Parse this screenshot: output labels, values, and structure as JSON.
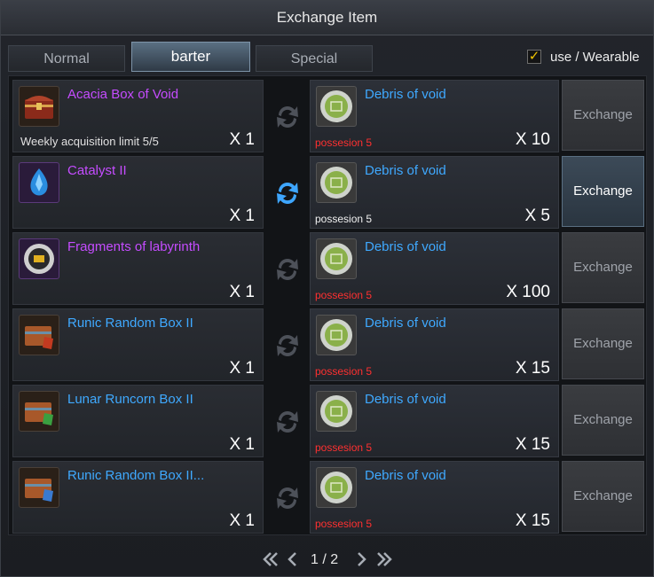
{
  "window": {
    "title": "Exchange Item"
  },
  "tabs": [
    {
      "label": "Normal"
    },
    {
      "label": "barter"
    },
    {
      "label": "Special"
    }
  ],
  "filter": {
    "label": "use / Wearable",
    "checked": true
  },
  "rows": [
    {
      "give_name": "Acacia Box of Void",
      "give_weekly": "Weekly acquisition limit 5/5",
      "give_qty": "X 1",
      "get_name": "Debris of void",
      "get_possession": "possesion 5",
      "get_qty": "X 10",
      "button": "Exchange"
    },
    {
      "give_name": "Catalyst II",
      "give_qty": "X 1",
      "get_name": "Debris of void",
      "get_possession": "possesion 5",
      "get_qty": "X 5",
      "button": "Exchange"
    },
    {
      "give_name": "Fragments of labyrinth",
      "give_qty": "X 1",
      "get_name": "Debris of void",
      "get_possession": "possesion 5",
      "get_qty": "X 100",
      "button": "Exchange"
    },
    {
      "give_name": "Runic Random Box II",
      "give_qty": "X 1",
      "get_name": "Debris of void",
      "get_possession": "possesion 5",
      "get_qty": "X 15",
      "button": "Exchange"
    },
    {
      "give_name": "Lunar Runcorn Box II",
      "give_qty": "X 1",
      "get_name": "Debris of void",
      "get_possession": "possesion 5",
      "get_qty": "X 15",
      "button": "Exchange"
    },
    {
      "give_name": "Runic Random Box II...",
      "give_qty": "X 1",
      "get_name": "Debris of void",
      "get_possession": "possesion 5",
      "get_qty": "X 15",
      "button": "Exchange"
    }
  ],
  "pagination": {
    "text": "1 / 2"
  },
  "colors": {
    "name_purple": "#c54cff",
    "name_blue": "#3fa9ff",
    "possession_warn": "#ff3030",
    "check": "#f0c400"
  },
  "icons": {
    "tabs_active": "barter",
    "swap": "swap-arrows-icon",
    "first": "double-chevron-left-icon",
    "prev": "chevron-left-icon",
    "next": "chevron-right-icon",
    "last": "double-chevron-right-icon"
  }
}
